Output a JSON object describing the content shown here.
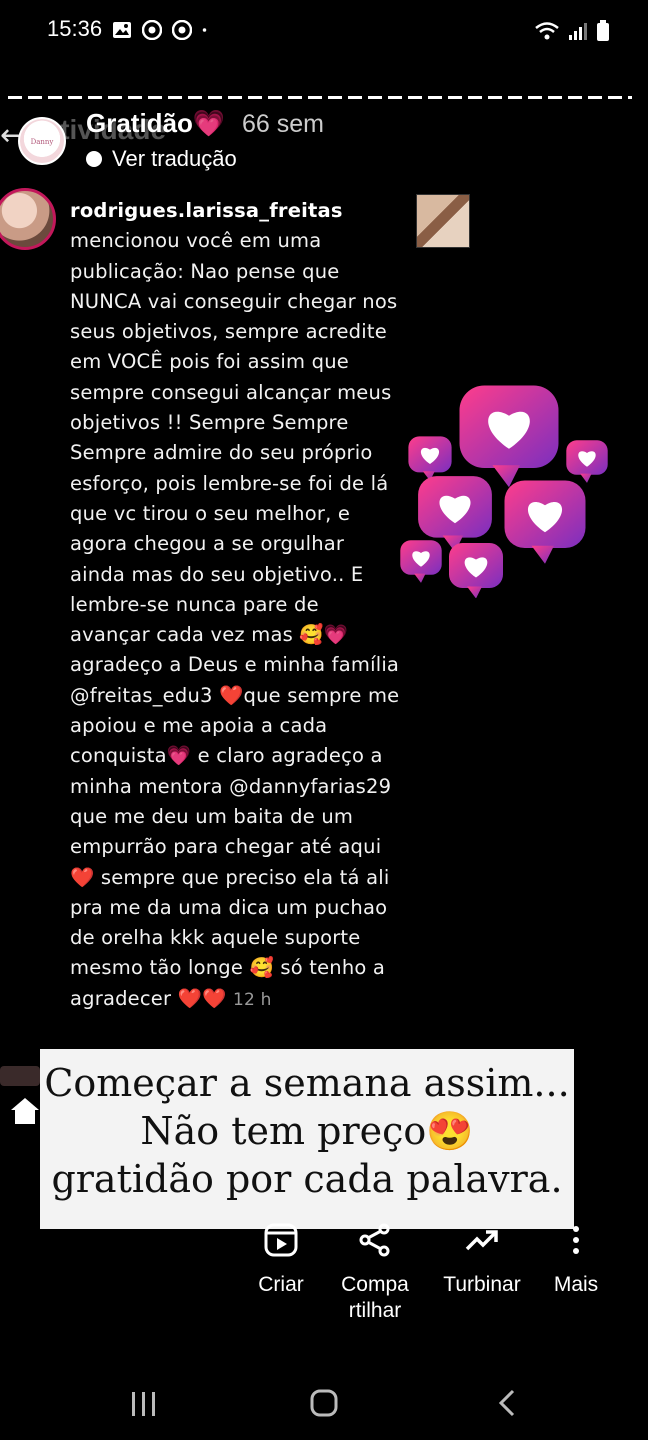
{
  "status_bar": {
    "time": "15:36",
    "left_icons": [
      "image-icon",
      "chrome-icon",
      "chrome-icon",
      "dot-icon"
    ],
    "right_icons": [
      "wifi-icon",
      "signal-icon",
      "battery-icon"
    ]
  },
  "header": {
    "ghost_title": "Atividade",
    "story_title": "Gratidão💗",
    "story_time": "66 sem",
    "translate_label": "Ver tradução"
  },
  "notification": {
    "username": "rodrigues.larissa_freitas",
    "message": "mencionou você em uma publicação: Nao pense que NUNCA vai conseguir chegar nos seus objetivos, sempre acredite em VOCÊ  pois foi assim que sempre consegui alcançar meus objetivos !! Sempre Sempre Sempre admire do seu próprio esforço, pois lembre-se foi de lá que vc tirou o seu melhor, e agora chegou a se orgulhar ainda mas do seu objetivo.. E lembre-se nunca pare de avançar cada vez mas 🥰💗 agradeço a Deus e minha família @freitas_edu3 ❤️que sempre me apoiou e me apoia a cada conquista💗 e claro agradeço a minha mentora @dannyfarias29 que me deu um baita de um empurrão para chegar até aqui❤️ sempre que preciso ela tá ali pra me da uma dica um puchao de orelha kkk aquele suporte mesmo tão longe 🥰 só tenho a agradecer ❤️❤️",
    "time": "12 h"
  },
  "caption": {
    "line1": "Começar a semana assim...",
    "line2": "Não tem preço😍",
    "line3": "gratidão por cada palavra."
  },
  "actions": [
    {
      "label": "Criar",
      "icon": "reel-icon"
    },
    {
      "label": "Compa\nrtilhar",
      "icon": "share-icon"
    },
    {
      "label": "Turbinar",
      "icon": "trending-icon"
    },
    {
      "label": "Mais",
      "icon": "more-vertical-icon"
    }
  ],
  "nav": [
    "recents-icon",
    "home-circle-icon",
    "back-icon"
  ],
  "colors": {
    "background": "#000000",
    "heart_magenta": "#e0218a",
    "heart_purple": "#7b2fbf",
    "caption_bg": "#f3f3f3"
  }
}
